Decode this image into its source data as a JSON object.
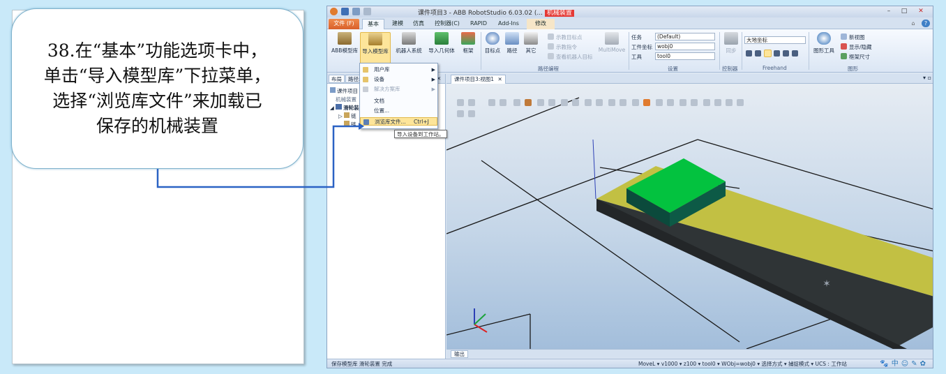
{
  "instruction": {
    "lines": [
      "38.在“基本”功能选项卡中，",
      "单击“导入模型库”下拉菜单，",
      "选择“浏览库文件”来加载已",
      "保存的机械装置"
    ]
  },
  "window": {
    "title_prefix": "课件项目3 - ABB RobotStudio 6.03.02 (...",
    "title_highlight": "机械装置",
    "min": "–",
    "max": "□",
    "close": "✕"
  },
  "tabs": [
    {
      "label": "文件 (F)"
    },
    {
      "label": "基本"
    },
    {
      "label": "建模"
    },
    {
      "label": "仿真"
    },
    {
      "label": "控制器(C)"
    },
    {
      "label": "RAPID"
    },
    {
      "label": "Add-Ins"
    },
    {
      "label": "修改"
    }
  ],
  "ribbon": {
    "abb_library": "ABB模型库",
    "import_library": "导入模型库",
    "robot_system": "机器人系统",
    "import_geometry": "导入几何体",
    "frame": "框架",
    "target": "目标点",
    "path": "路径",
    "other": "其它",
    "teach_target": "示教目标点",
    "teach_instruction": "示教指令",
    "view_robot_target": "查看机器人目标",
    "multimove": "MultiMove",
    "path_programming": "路径编程",
    "task_label": "任务",
    "task_value": "(Default)",
    "wobj_label": "工件坐标",
    "wobj_value": "wobj0",
    "tool_label": "工具",
    "tool_value": "tool0",
    "settings": "设置",
    "sync": "同步",
    "controller": "控制器",
    "coord_value": "大地坐标",
    "freehand": "Freehand",
    "graphic_tools": "图形工具",
    "new_view": "新视图",
    "show_hide": "显示/隐藏",
    "frame_size": "框架尺寸",
    "graphics": "图形"
  },
  "browser": {
    "tab_layout": "布局",
    "tab_paths": "路径和",
    "close": "✕",
    "items": [
      "课件项目",
      "机械装置",
      "滑轮装",
      "链",
      "链"
    ]
  },
  "dropdown": {
    "items": [
      {
        "label": "用户库",
        "arrow": "▶"
      },
      {
        "label": "设备",
        "arrow": "▶"
      },
      {
        "label": "解决方案库",
        "arrow": "▶"
      },
      {
        "label": "文档"
      },
      {
        "label": "位置..."
      },
      {
        "label": "浏览库文件...",
        "shortcut": "Ctrl+J"
      }
    ],
    "tooltip": "导入设备到工作站。"
  },
  "view": {
    "tab": "课件项目3:视图1",
    "close": "✕"
  },
  "output": {
    "tab": "输出"
  },
  "status": {
    "left": "保存模型库 滑轮装置 完成",
    "right": "MoveL ▾  v1000 ▾  z100 ▾  tool0 ▾  WObj=wobj0 ▾   选择方式 ▾  捕捉模式 ▾   UCS : 工作站",
    "icons": "🐾中☺✎✿"
  },
  "colors": {
    "accent_orange": "#d9602b",
    "highlight_yellow": "#fde59a",
    "connector_blue": "#2b62c4",
    "table_yellow": "#c2c043",
    "box_green": "#03c23f"
  }
}
